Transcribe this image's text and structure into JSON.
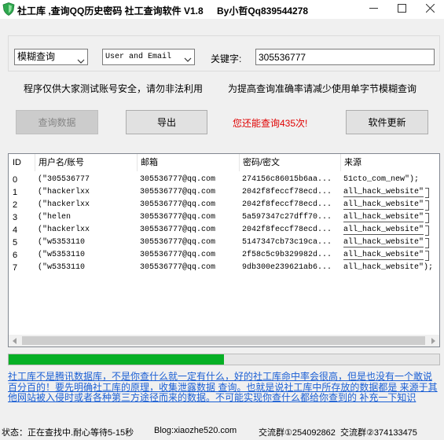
{
  "window": {
    "title": "社工库 ,查询QQ历史密码 社工查询软件 V1.8",
    "author": "By小哲Qq839544278",
    "icons": {
      "app": "shield-icon",
      "minimize": "minimize-icon",
      "maximize": "maximize-icon",
      "close": "close-icon"
    }
  },
  "search": {
    "mode_select": "模糊查询",
    "field_select": "User and Email",
    "keyword_label": "关键字:",
    "keyword_value": "305536777"
  },
  "notices": {
    "left": "程序仅供大家测试账号安全，请勿非法利用",
    "right": "为提高查询准确率请减少使用单字节模糊查询"
  },
  "actions": {
    "query_label": "查询数据",
    "query_enabled": false,
    "export_label": "导出",
    "remaining": "您还能查询435次!",
    "update_label": "软件更新"
  },
  "results": {
    "columns": [
      "ID",
      "用户名/账号",
      "邮箱",
      "密码/密文",
      "来源"
    ],
    "rows": [
      [
        "0",
        "(\"305536777",
        "305536777@qq.com",
        "274156c86015b6aa...",
        "51cto_com_new\");"
      ],
      [
        "1",
        "(\"hackerlxx",
        "305536777@qq.com",
        "2042f8feccf78ecd...",
        "all_hack_website\""
      ],
      [
        "2",
        "(\"hackerlxx",
        "305536777@qq.com",
        "2042f8feccf78ecd...",
        "all_hack_website\""
      ],
      [
        "3",
        "(\"helen",
        "305536777@qq.com",
        "5a597347c27dff70...",
        "all_hack_website\""
      ],
      [
        "4",
        "(\"hackerlxx",
        "305536777@qq.com",
        "2042f8feccf78ecd...",
        "all_hack_website\""
      ],
      [
        "5",
        "(\"w5353110",
        "305536777@qq.com",
        "5147347cb73c19ca...",
        "all_hack_website\""
      ],
      [
        "6",
        "(\"w5353110",
        "305536777@qq.com",
        "2f58c5c9b329982d...",
        "all_hack_website\""
      ],
      [
        "7",
        "(\"w5353110",
        "305536777@qq.com",
        "9db300e239621ab6...",
        "all_hack_website\");"
      ]
    ]
  },
  "progress": {
    "value": 0.5
  },
  "info_text": "社工库不是腾讯数据库，不是你查什么就一定有什么，好的社工库命中率会很高，但是也没有一个敢说百分百的！要先明确社工库的原理，收集泄露数据 查询。也就是说社工库中所存放的数据都是 来源于其他网站被入侵时或者各种第三方途径而来的数据。不可能实现你查什么都给你查到的 补充一下知识",
  "status_bar": {
    "status": "状态：正在查找中.耐心等待5-15秒",
    "blog": "Blog:xiaozhe520.com",
    "group1": "交流群①254092862",
    "group2": "交流群②374133475"
  },
  "colors": {
    "progress_fill": "#06b025",
    "remaining_text": "#e00000",
    "info_text": "#1b5fd4",
    "app_icon": "#2fa84f"
  }
}
